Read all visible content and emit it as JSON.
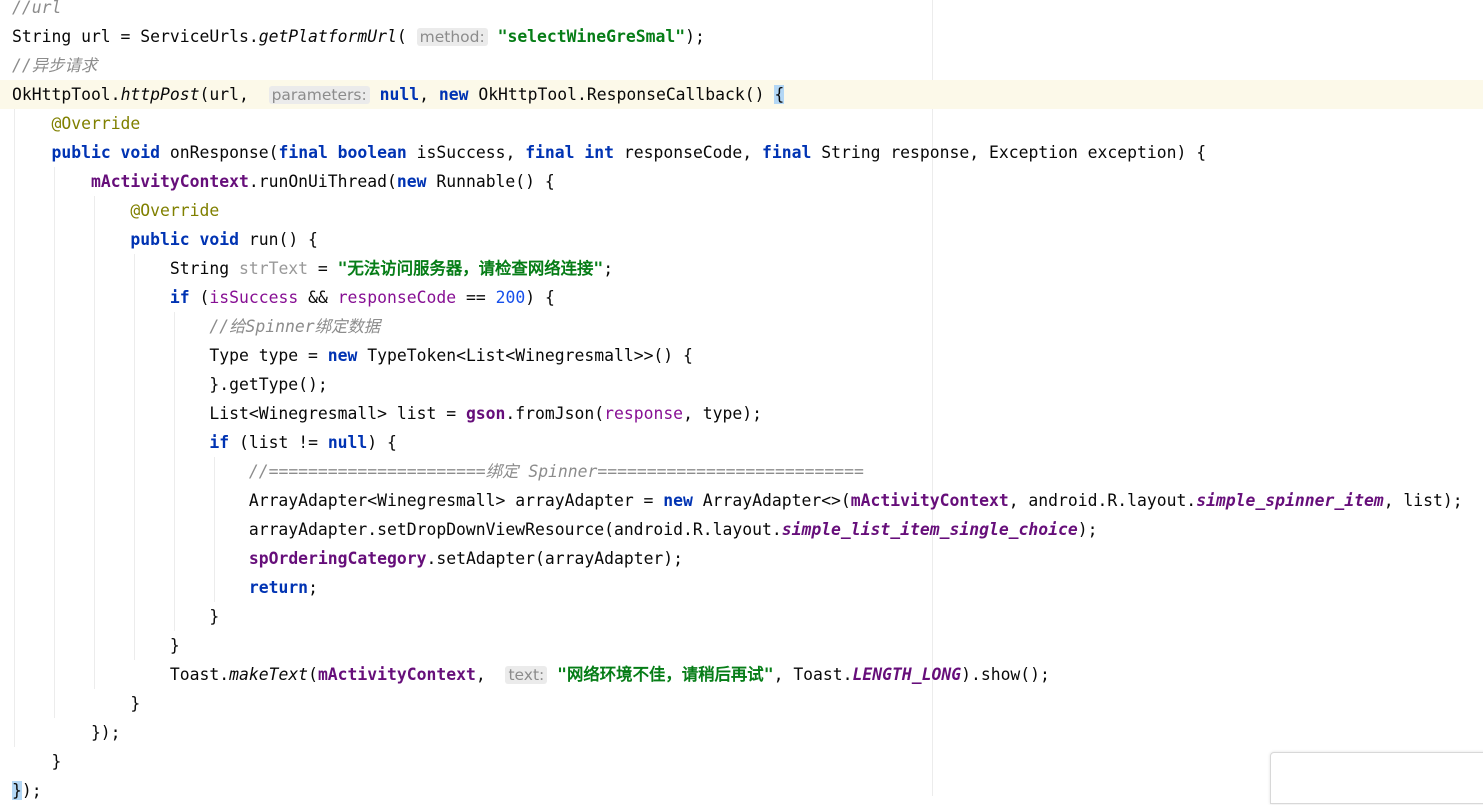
{
  "editor": {
    "lines": [
      [
        [
          "cmt",
          "//url"
        ]
      ],
      [
        [
          "txt",
          "String url = ServiceUrls."
        ],
        [
          "it",
          "getPlatformUrl"
        ],
        [
          "txt",
          "( "
        ],
        [
          "hint",
          "method:"
        ],
        [
          "txt",
          " "
        ],
        [
          "str",
          "\"selectWineGreSmal\""
        ],
        [
          "txt",
          ");"
        ]
      ],
      [
        [
          "cmt",
          "//异步请求"
        ]
      ],
      [
        [
          "txt",
          "OkHttpTool."
        ],
        [
          "it",
          "httpPost"
        ],
        [
          "txt",
          "(url,  "
        ],
        [
          "hint",
          "parameters:"
        ],
        [
          "txt",
          " "
        ],
        [
          "kw",
          "null"
        ],
        [
          "txt",
          ", "
        ],
        [
          "kw",
          "new"
        ],
        [
          "txt",
          " OkHttpTool.ResponseCallback() "
        ],
        [
          "brace",
          "{"
        ]
      ],
      [
        [
          "txt",
          "    "
        ],
        [
          "ann",
          "@Override"
        ]
      ],
      [
        [
          "txt",
          "    "
        ],
        [
          "kw",
          "public void"
        ],
        [
          "txt",
          " onResponse("
        ],
        [
          "kw",
          "final boolean"
        ],
        [
          "txt",
          " isSuccess, "
        ],
        [
          "kw",
          "final int"
        ],
        [
          "txt",
          " responseCode, "
        ],
        [
          "kw",
          "final"
        ],
        [
          "txt",
          " String response, Exception exception) {"
        ]
      ],
      [
        [
          "txt",
          "        "
        ],
        [
          "fld",
          "mActivityContext"
        ],
        [
          "txt",
          ".runOnUiThread("
        ],
        [
          "kw",
          "new"
        ],
        [
          "txt",
          " Runnable() {"
        ]
      ],
      [
        [
          "txt",
          "            "
        ],
        [
          "ann",
          "@Override"
        ]
      ],
      [
        [
          "txt",
          "            "
        ],
        [
          "kw",
          "public void"
        ],
        [
          "txt",
          " run() {"
        ]
      ],
      [
        [
          "txt",
          "                String "
        ],
        [
          "gr",
          "strText"
        ],
        [
          "txt",
          " = "
        ],
        [
          "str",
          "\"无法访问服务器，请检查网络连接\""
        ],
        [
          "txt",
          ";"
        ]
      ],
      [
        [
          "txt",
          "                "
        ],
        [
          "kw",
          "if"
        ],
        [
          "txt",
          " ("
        ],
        [
          "par",
          "isSuccess"
        ],
        [
          "txt",
          " && "
        ],
        [
          "par",
          "responseCode"
        ],
        [
          "txt",
          " == "
        ],
        [
          "num",
          "200"
        ],
        [
          "txt",
          ") {"
        ]
      ],
      [
        [
          "txt",
          "                    "
        ],
        [
          "cmt",
          "//给Spinner绑定数据"
        ]
      ],
      [
        [
          "txt",
          "                    Type type = "
        ],
        [
          "kw",
          "new"
        ],
        [
          "txt",
          " TypeToken<List<Winegresmall>>() {"
        ]
      ],
      [
        [
          "txt",
          "                    }.getType();"
        ]
      ],
      [
        [
          "txt",
          "                    List<Winegresmall> list = "
        ],
        [
          "fld",
          "gson"
        ],
        [
          "txt",
          ".fromJson("
        ],
        [
          "par",
          "response"
        ],
        [
          "txt",
          ", type);"
        ]
      ],
      [
        [
          "txt",
          "                    "
        ],
        [
          "kw",
          "if"
        ],
        [
          "txt",
          " (list != "
        ],
        [
          "kw",
          "null"
        ],
        [
          "txt",
          ") {"
        ]
      ],
      [
        [
          "txt",
          "                        "
        ],
        [
          "cmt",
          "//======================绑定 Spinner==========================="
        ]
      ],
      [
        [
          "txt",
          "                        ArrayAdapter<Winegresmall> arrayAdapter = "
        ],
        [
          "kw",
          "new"
        ],
        [
          "txt",
          " ArrayAdapter<>("
        ],
        [
          "fld",
          "mActivityContext"
        ],
        [
          "txt",
          ", android.R.layout."
        ],
        [
          "sf",
          "simple_spinner_item"
        ],
        [
          "txt",
          ", list);"
        ]
      ],
      [
        [
          "txt",
          "                        arrayAdapter.setDropDownViewResource(android.R.layout."
        ],
        [
          "sf",
          "simple_list_item_single_choice"
        ],
        [
          "txt",
          ");"
        ]
      ],
      [
        [
          "txt",
          "                        "
        ],
        [
          "fld",
          "spOrderingCategory"
        ],
        [
          "txt",
          ".setAdapter(arrayAdapter);"
        ]
      ],
      [
        [
          "txt",
          "                        "
        ],
        [
          "kw",
          "return"
        ],
        [
          "txt",
          ";"
        ]
      ],
      [
        [
          "txt",
          "                    }"
        ]
      ],
      [
        [
          "txt",
          "                }"
        ]
      ],
      [
        [
          "txt",
          "                Toast."
        ],
        [
          "it",
          "makeText"
        ],
        [
          "txt",
          "("
        ],
        [
          "fld",
          "mActivityContext"
        ],
        [
          "txt",
          ",  "
        ],
        [
          "hint",
          "text:"
        ],
        [
          "txt",
          " "
        ],
        [
          "str",
          "\"网络环境不佳，请稍后再试\""
        ],
        [
          "txt",
          ", Toast."
        ],
        [
          "sf",
          "LENGTH_LONG"
        ],
        [
          "txt",
          ").show();"
        ]
      ],
      [
        [
          "txt",
          "            }"
        ]
      ],
      [
        [
          "txt",
          "        });"
        ]
      ],
      [
        [
          "txt",
          "    }"
        ]
      ],
      [
        [
          "brace",
          "}"
        ],
        [
          "txt",
          ");"
        ]
      ]
    ],
    "current_line": 3
  }
}
